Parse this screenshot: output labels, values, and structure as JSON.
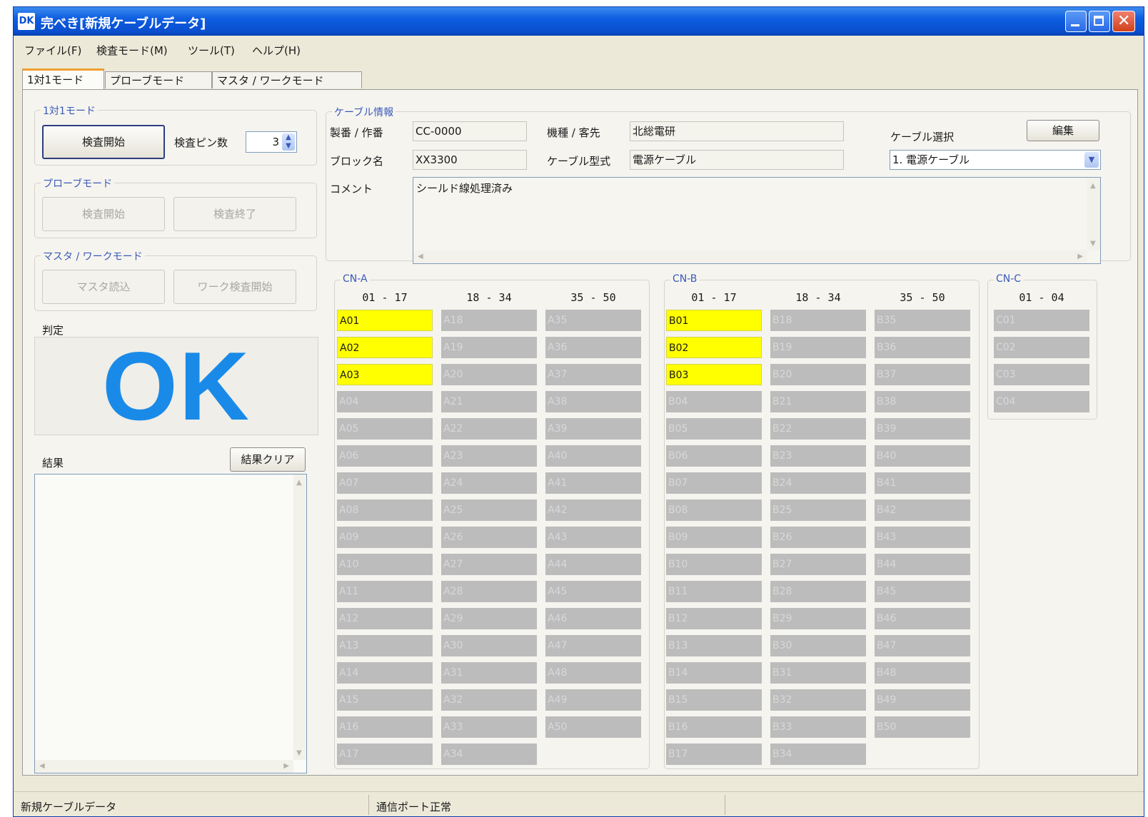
{
  "window": {
    "icon_text": "DK",
    "title": "完べき[新規ケーブルデータ]"
  },
  "menu": [
    "ファイル(F)",
    "検査モード(M)",
    "ツール(T)",
    "ヘルプ(H)"
  ],
  "tabs": [
    "1対1モード",
    "プローブモード",
    "マスタ / ワークモード"
  ],
  "left_panel": {
    "one_to_one": {
      "title": "1対1モード",
      "start_label": "検査開始",
      "pin_count_label": "検査ピン数",
      "pin_count_value": "3"
    },
    "probe": {
      "title": "プローブモード",
      "start_label": "検査開始",
      "end_label": "検査終了"
    },
    "master_work": {
      "title": "マスタ / ワークモード",
      "read_label": "マスタ読込",
      "work_start_label": "ワーク検査開始"
    },
    "judgement_label": "判定",
    "judgement_value": "OK",
    "result_label": "結果",
    "clear_label": "結果クリア"
  },
  "cable_info": {
    "title": "ケーブル情報",
    "number_label": "製番 / 作番",
    "number_value": "CC-0000",
    "model_label": "機種 / 客先",
    "model_value": "北総電研",
    "block_label": "ブロック名",
    "block_value": "XX3300",
    "cable_type_label": "ケーブル型式",
    "cable_type_value": "電源ケーブル",
    "select_label": "ケーブル選択",
    "edit_label": "編集",
    "select_value": "1. 電源ケーブル",
    "comment_label": "コメント",
    "comment_value": "シールド線処理済み"
  },
  "connectors": [
    {
      "name": "CN-A",
      "ranges": [
        "01 - 17",
        "18 - 34",
        "35 - 50"
      ],
      "columns": [
        [
          "A01",
          "A02",
          "A03",
          "A04",
          "A05",
          "A06",
          "A07",
          "A08",
          "A09",
          "A10",
          "A11",
          "A12",
          "A13",
          "A14",
          "A15",
          "A16",
          "A17"
        ],
        [
          "A18",
          "A19",
          "A20",
          "A21",
          "A22",
          "A23",
          "A24",
          "A25",
          "A26",
          "A27",
          "A28",
          "A29",
          "A30",
          "A31",
          "A32",
          "A33",
          "A34"
        ],
        [
          "A35",
          "A36",
          "A37",
          "A38",
          "A39",
          "A40",
          "A41",
          "A42",
          "A43",
          "A44",
          "A45",
          "A46",
          "A47",
          "A48",
          "A49",
          "A50"
        ]
      ]
    },
    {
      "name": "CN-B",
      "ranges": [
        "01 - 17",
        "18 - 34",
        "35 - 50"
      ],
      "columns": [
        [
          "B01",
          "B02",
          "B03",
          "B04",
          "B05",
          "B06",
          "B07",
          "B08",
          "B09",
          "B10",
          "B11",
          "B12",
          "B13",
          "B14",
          "B15",
          "B16",
          "B17"
        ],
        [
          "B18",
          "B19",
          "B20",
          "B21",
          "B22",
          "B23",
          "B24",
          "B25",
          "B26",
          "B27",
          "B28",
          "B29",
          "B30",
          "B31",
          "B32",
          "B33",
          "B34"
        ],
        [
          "B35",
          "B36",
          "B37",
          "B38",
          "B39",
          "B40",
          "B41",
          "B42",
          "B43",
          "B44",
          "B45",
          "B46",
          "B47",
          "B48",
          "B49",
          "B50"
        ]
      ]
    },
    {
      "name": "CN-C",
      "ranges": [
        "01 - 04"
      ],
      "columns": [
        [
          "C01",
          "C02",
          "C03",
          "C04"
        ]
      ]
    }
  ],
  "active_pins": [
    "A01",
    "A02",
    "A03",
    "B01",
    "B02",
    "B03"
  ],
  "colors": {
    "active_pin": "#ffff00",
    "inactive_pin": "#bcbcbc",
    "judgement_ok": "#1a8ae8"
  },
  "statusbar": [
    "新規ケーブルデータ",
    "通信ポート正常"
  ]
}
